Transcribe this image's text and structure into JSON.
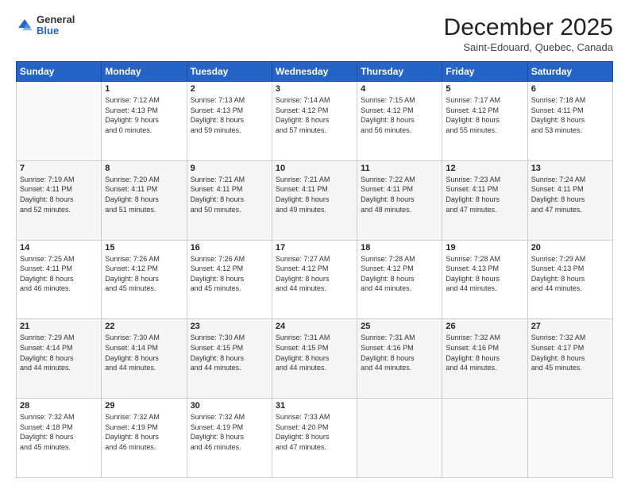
{
  "header": {
    "logo_general": "General",
    "logo_blue": "Blue",
    "month_title": "December 2025",
    "location": "Saint-Edouard, Quebec, Canada"
  },
  "weekdays": [
    "Sunday",
    "Monday",
    "Tuesday",
    "Wednesday",
    "Thursday",
    "Friday",
    "Saturday"
  ],
  "weeks": [
    [
      {
        "day": "",
        "info": ""
      },
      {
        "day": "1",
        "info": "Sunrise: 7:12 AM\nSunset: 4:13 PM\nDaylight: 9 hours\nand 0 minutes."
      },
      {
        "day": "2",
        "info": "Sunrise: 7:13 AM\nSunset: 4:13 PM\nDaylight: 8 hours\nand 59 minutes."
      },
      {
        "day": "3",
        "info": "Sunrise: 7:14 AM\nSunset: 4:12 PM\nDaylight: 8 hours\nand 57 minutes."
      },
      {
        "day": "4",
        "info": "Sunrise: 7:15 AM\nSunset: 4:12 PM\nDaylight: 8 hours\nand 56 minutes."
      },
      {
        "day": "5",
        "info": "Sunrise: 7:17 AM\nSunset: 4:12 PM\nDaylight: 8 hours\nand 55 minutes."
      },
      {
        "day": "6",
        "info": "Sunrise: 7:18 AM\nSunset: 4:11 PM\nDaylight: 8 hours\nand 53 minutes."
      }
    ],
    [
      {
        "day": "7",
        "info": "Sunrise: 7:19 AM\nSunset: 4:11 PM\nDaylight: 8 hours\nand 52 minutes."
      },
      {
        "day": "8",
        "info": "Sunrise: 7:20 AM\nSunset: 4:11 PM\nDaylight: 8 hours\nand 51 minutes."
      },
      {
        "day": "9",
        "info": "Sunrise: 7:21 AM\nSunset: 4:11 PM\nDaylight: 8 hours\nand 50 minutes."
      },
      {
        "day": "10",
        "info": "Sunrise: 7:21 AM\nSunset: 4:11 PM\nDaylight: 8 hours\nand 49 minutes."
      },
      {
        "day": "11",
        "info": "Sunrise: 7:22 AM\nSunset: 4:11 PM\nDaylight: 8 hours\nand 48 minutes."
      },
      {
        "day": "12",
        "info": "Sunrise: 7:23 AM\nSunset: 4:11 PM\nDaylight: 8 hours\nand 47 minutes."
      },
      {
        "day": "13",
        "info": "Sunrise: 7:24 AM\nSunset: 4:11 PM\nDaylight: 8 hours\nand 47 minutes."
      }
    ],
    [
      {
        "day": "14",
        "info": "Sunrise: 7:25 AM\nSunset: 4:11 PM\nDaylight: 8 hours\nand 46 minutes."
      },
      {
        "day": "15",
        "info": "Sunrise: 7:26 AM\nSunset: 4:12 PM\nDaylight: 8 hours\nand 45 minutes."
      },
      {
        "day": "16",
        "info": "Sunrise: 7:26 AM\nSunset: 4:12 PM\nDaylight: 8 hours\nand 45 minutes."
      },
      {
        "day": "17",
        "info": "Sunrise: 7:27 AM\nSunset: 4:12 PM\nDaylight: 8 hours\nand 44 minutes."
      },
      {
        "day": "18",
        "info": "Sunrise: 7:28 AM\nSunset: 4:12 PM\nDaylight: 8 hours\nand 44 minutes."
      },
      {
        "day": "19",
        "info": "Sunrise: 7:28 AM\nSunset: 4:13 PM\nDaylight: 8 hours\nand 44 minutes."
      },
      {
        "day": "20",
        "info": "Sunrise: 7:29 AM\nSunset: 4:13 PM\nDaylight: 8 hours\nand 44 minutes."
      }
    ],
    [
      {
        "day": "21",
        "info": "Sunrise: 7:29 AM\nSunset: 4:14 PM\nDaylight: 8 hours\nand 44 minutes."
      },
      {
        "day": "22",
        "info": "Sunrise: 7:30 AM\nSunset: 4:14 PM\nDaylight: 8 hours\nand 44 minutes."
      },
      {
        "day": "23",
        "info": "Sunrise: 7:30 AM\nSunset: 4:15 PM\nDaylight: 8 hours\nand 44 minutes."
      },
      {
        "day": "24",
        "info": "Sunrise: 7:31 AM\nSunset: 4:15 PM\nDaylight: 8 hours\nand 44 minutes."
      },
      {
        "day": "25",
        "info": "Sunrise: 7:31 AM\nSunset: 4:16 PM\nDaylight: 8 hours\nand 44 minutes."
      },
      {
        "day": "26",
        "info": "Sunrise: 7:32 AM\nSunset: 4:16 PM\nDaylight: 8 hours\nand 44 minutes."
      },
      {
        "day": "27",
        "info": "Sunrise: 7:32 AM\nSunset: 4:17 PM\nDaylight: 8 hours\nand 45 minutes."
      }
    ],
    [
      {
        "day": "28",
        "info": "Sunrise: 7:32 AM\nSunset: 4:18 PM\nDaylight: 8 hours\nand 45 minutes."
      },
      {
        "day": "29",
        "info": "Sunrise: 7:32 AM\nSunset: 4:19 PM\nDaylight: 8 hours\nand 46 minutes."
      },
      {
        "day": "30",
        "info": "Sunrise: 7:32 AM\nSunset: 4:19 PM\nDaylight: 8 hours\nand 46 minutes."
      },
      {
        "day": "31",
        "info": "Sunrise: 7:33 AM\nSunset: 4:20 PM\nDaylight: 8 hours\nand 47 minutes."
      },
      {
        "day": "",
        "info": ""
      },
      {
        "day": "",
        "info": ""
      },
      {
        "day": "",
        "info": ""
      }
    ]
  ]
}
